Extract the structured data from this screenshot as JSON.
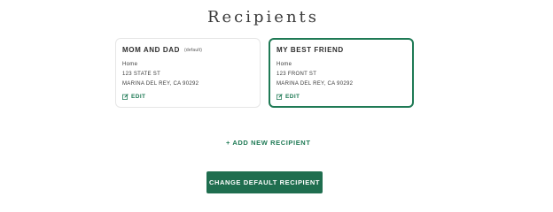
{
  "page_title": "Recipients",
  "recipients": [
    {
      "name": "MOM AND DAD",
      "default_label": "(default)",
      "address_type": "Home",
      "street": "123 STATE ST",
      "city_line": "MARINA DEL REY, CA 90292",
      "edit_label": "EDIT",
      "selected": false
    },
    {
      "name": "MY BEST FRIEND",
      "address_type": "Home",
      "street": "123 FRONT ST",
      "city_line": "MARINA DEL REY, CA 90292",
      "edit_label": "EDIT",
      "selected": true
    }
  ],
  "add_recipient_label": "+ ADD NEW RECIPIENT",
  "change_default_label": "CHANGE DEFAULT RECIPIENT",
  "colors": {
    "accent": "#1f7a55",
    "button": "#1f6e4f"
  },
  "icons": {
    "edit": "edit-icon"
  }
}
